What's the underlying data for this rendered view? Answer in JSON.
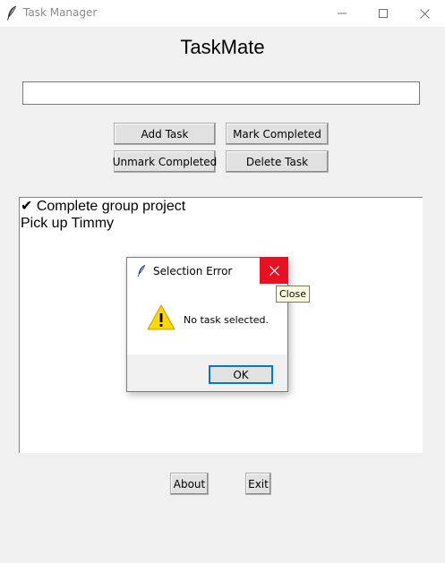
{
  "window": {
    "title": "Task Manager",
    "icons": {
      "app": "feather-icon",
      "minimize": "minimize-icon",
      "maximize": "maximize-icon",
      "close": "close-icon"
    }
  },
  "app": {
    "heading": "TaskMate",
    "entry": {
      "value": "",
      "placeholder": ""
    },
    "buttons": {
      "add": "Add Task",
      "mark": "Mark Completed",
      "unmark": "Unmark Completed",
      "delete": "Delete Task",
      "about": "About",
      "exit": "Exit"
    },
    "tasks": [
      {
        "text": "✔ Complete group project"
      },
      {
        "text": "Pick up Timmy"
      }
    ]
  },
  "dialog": {
    "title": "Selection Error",
    "message": "No task selected.",
    "ok_label": "OK",
    "icons": {
      "app": "feather-icon",
      "warning": "warning-icon",
      "close": "close-icon"
    },
    "close_color": "#e81123"
  },
  "tooltip": {
    "text": "Close"
  },
  "colors": {
    "background": "#f0f0f0",
    "focus_border": "#0078d7",
    "warning_fill": "#ffd800"
  }
}
